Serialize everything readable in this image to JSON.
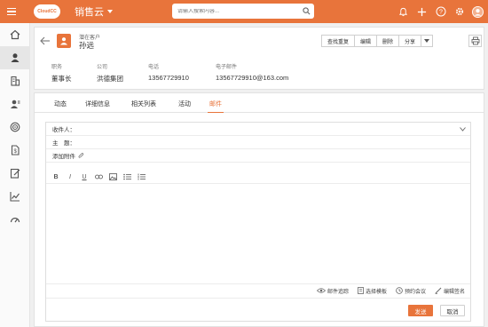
{
  "header": {
    "app_name": "销售云",
    "logo_text": "CloudCC",
    "search_placeholder": "请输入搜索内容..."
  },
  "record": {
    "type_label": "潜在客户",
    "name": "孙远",
    "buttons": [
      "查找重复",
      "编辑",
      "删除",
      "分享"
    ],
    "fields": [
      {
        "label": "职务",
        "value": "董事长"
      },
      {
        "label": "公司",
        "value": "洪德集团"
      },
      {
        "label": "电话",
        "value": "13567729910"
      },
      {
        "label": "电子邮件",
        "value": "13567729910@163.com"
      }
    ]
  },
  "tabs": [
    {
      "label": "动态",
      "active": false
    },
    {
      "label": "详细信息",
      "active": false
    },
    {
      "label": "相关列表",
      "active": false
    },
    {
      "label": "活动",
      "active": false
    },
    {
      "label": "邮件",
      "active": true
    }
  ],
  "email": {
    "recipient_label": "收件人：",
    "subject_label": "主　题：",
    "attachment_label": "添加附件",
    "tools": [
      "邮件追踪",
      "选择模板",
      "预约会议",
      "编辑签名"
    ],
    "send_label": "发送",
    "cancel_label": "取消"
  },
  "colors": {
    "brand": "#e8743b"
  }
}
